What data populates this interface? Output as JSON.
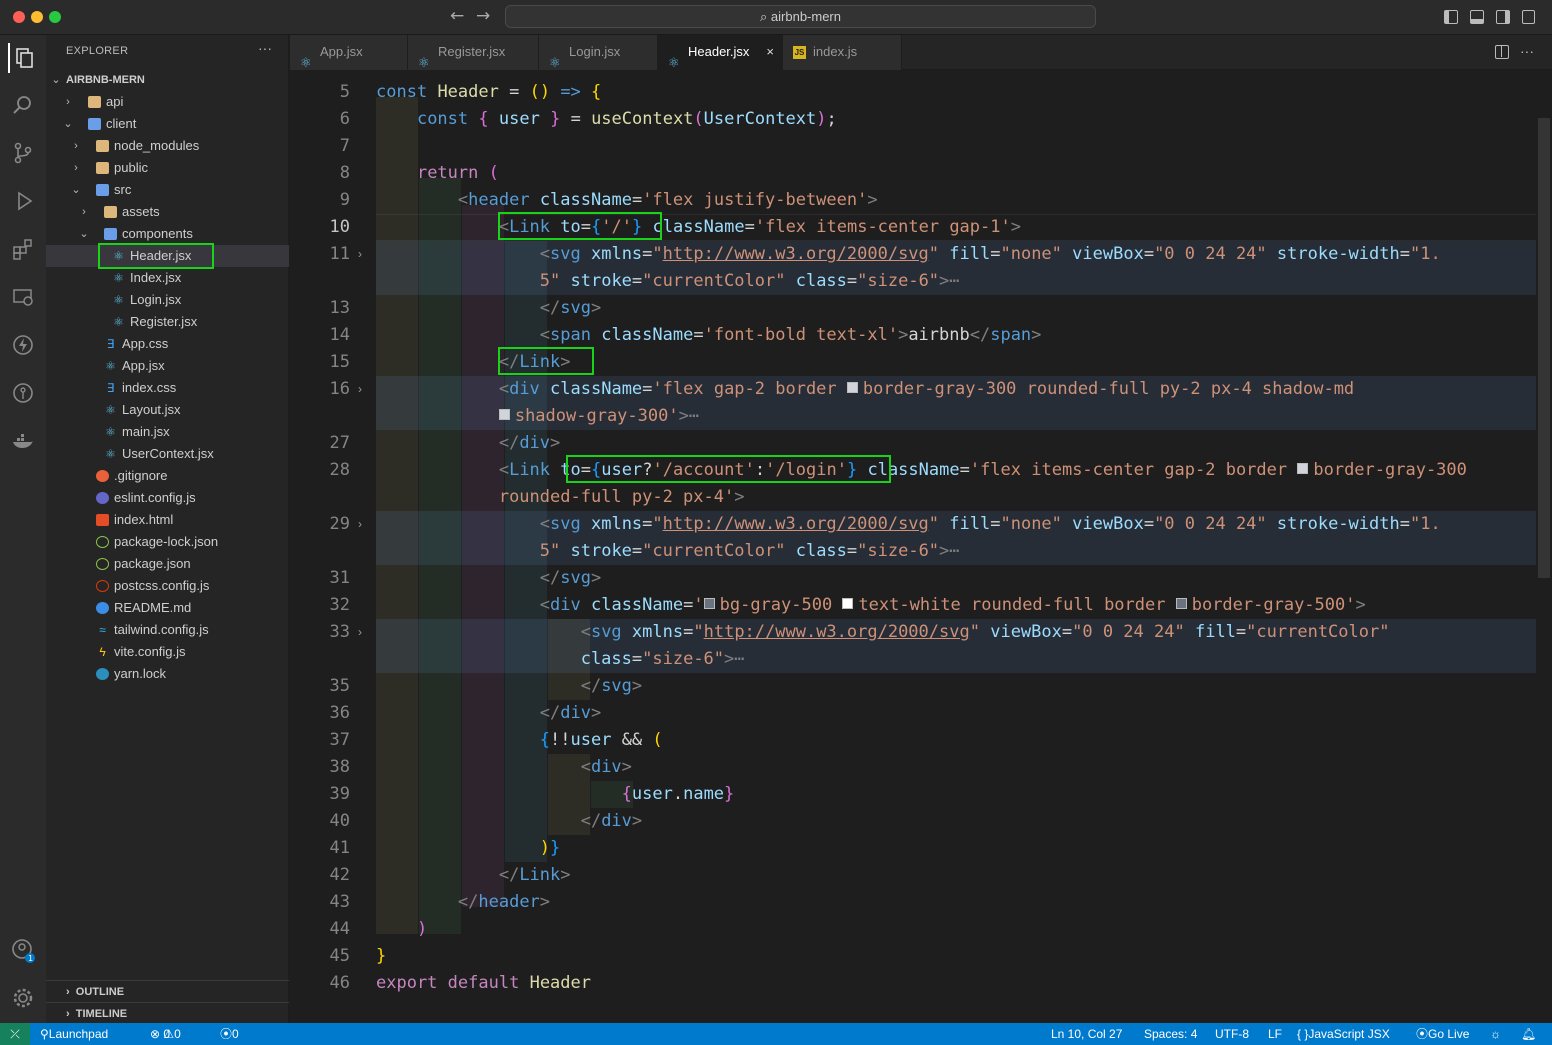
{
  "window": {
    "search": "airbnb-mern"
  },
  "explorer": {
    "title": "EXPLORER",
    "root": "AIRBNB-MERN",
    "items": [
      {
        "label": "api",
        "depth": 1,
        "kind": "folder"
      },
      {
        "label": "client",
        "depth": 1,
        "kind": "folder-open"
      },
      {
        "label": "node_modules",
        "depth": 2,
        "kind": "folder"
      },
      {
        "label": "public",
        "depth": 2,
        "kind": "folder"
      },
      {
        "label": "src",
        "depth": 2,
        "kind": "folder-open"
      },
      {
        "label": "assets",
        "depth": 3,
        "kind": "folder"
      },
      {
        "label": "components",
        "depth": 3,
        "kind": "folder-open"
      },
      {
        "label": "Header.jsx",
        "depth": 4,
        "kind": "react",
        "selected": true
      },
      {
        "label": "Index.jsx",
        "depth": 4,
        "kind": "react"
      },
      {
        "label": "Login.jsx",
        "depth": 4,
        "kind": "react"
      },
      {
        "label": "Register.jsx",
        "depth": 4,
        "kind": "react"
      },
      {
        "label": "App.css",
        "depth": 3,
        "kind": "css"
      },
      {
        "label": "App.jsx",
        "depth": 3,
        "kind": "react"
      },
      {
        "label": "index.css",
        "depth": 3,
        "kind": "css"
      },
      {
        "label": "Layout.jsx",
        "depth": 3,
        "kind": "react"
      },
      {
        "label": "main.jsx",
        "depth": 3,
        "kind": "react"
      },
      {
        "label": "UserContext.jsx",
        "depth": 3,
        "kind": "react"
      },
      {
        "label": ".gitignore",
        "depth": 2,
        "kind": "git"
      },
      {
        "label": "eslint.config.js",
        "depth": 2,
        "kind": "eslint"
      },
      {
        "label": "index.html",
        "depth": 2,
        "kind": "html"
      },
      {
        "label": "package-lock.json",
        "depth": 2,
        "kind": "node"
      },
      {
        "label": "package.json",
        "depth": 2,
        "kind": "node"
      },
      {
        "label": "postcss.config.js",
        "depth": 2,
        "kind": "postcss"
      },
      {
        "label": "README.md",
        "depth": 2,
        "kind": "info"
      },
      {
        "label": "tailwind.config.js",
        "depth": 2,
        "kind": "tailwind"
      },
      {
        "label": "vite.config.js",
        "depth": 2,
        "kind": "vite"
      },
      {
        "label": "yarn.lock",
        "depth": 2,
        "kind": "yarn"
      }
    ],
    "outline": "OUTLINE",
    "timeline": "TIMELINE"
  },
  "tabs": [
    {
      "label": "App.jsx",
      "icon": "react"
    },
    {
      "label": "Register.jsx",
      "icon": "react"
    },
    {
      "label": "Login.jsx",
      "icon": "react"
    },
    {
      "label": "Header.jsx",
      "icon": "react",
      "active": true
    },
    {
      "label": "index.js",
      "icon": "js"
    }
  ],
  "editor": {
    "line_numbers": [
      "5",
      "6",
      "7",
      "8",
      "9",
      "10",
      "11",
      "",
      "13",
      "14",
      "15",
      "16",
      "",
      "27",
      "28",
      "",
      "29",
      "",
      "31",
      "32",
      "33",
      "",
      "35",
      "36",
      "37",
      "38",
      "39",
      "40",
      "41",
      "42",
      "43",
      "44",
      "45",
      "46"
    ]
  },
  "statusbar": {
    "launchpad": "Launchpad",
    "errors": "0",
    "warnings": "0",
    "ports": "0",
    "position": "Ln 10, Col 27",
    "spaces": "Spaces: 4",
    "encoding": "UTF-8",
    "eol": "LF",
    "language": "JavaScript JSX",
    "golive": "Go Live"
  },
  "colors": {
    "accent": "#007acc",
    "highlight_box": "#18d318",
    "selection": "#37373d"
  }
}
